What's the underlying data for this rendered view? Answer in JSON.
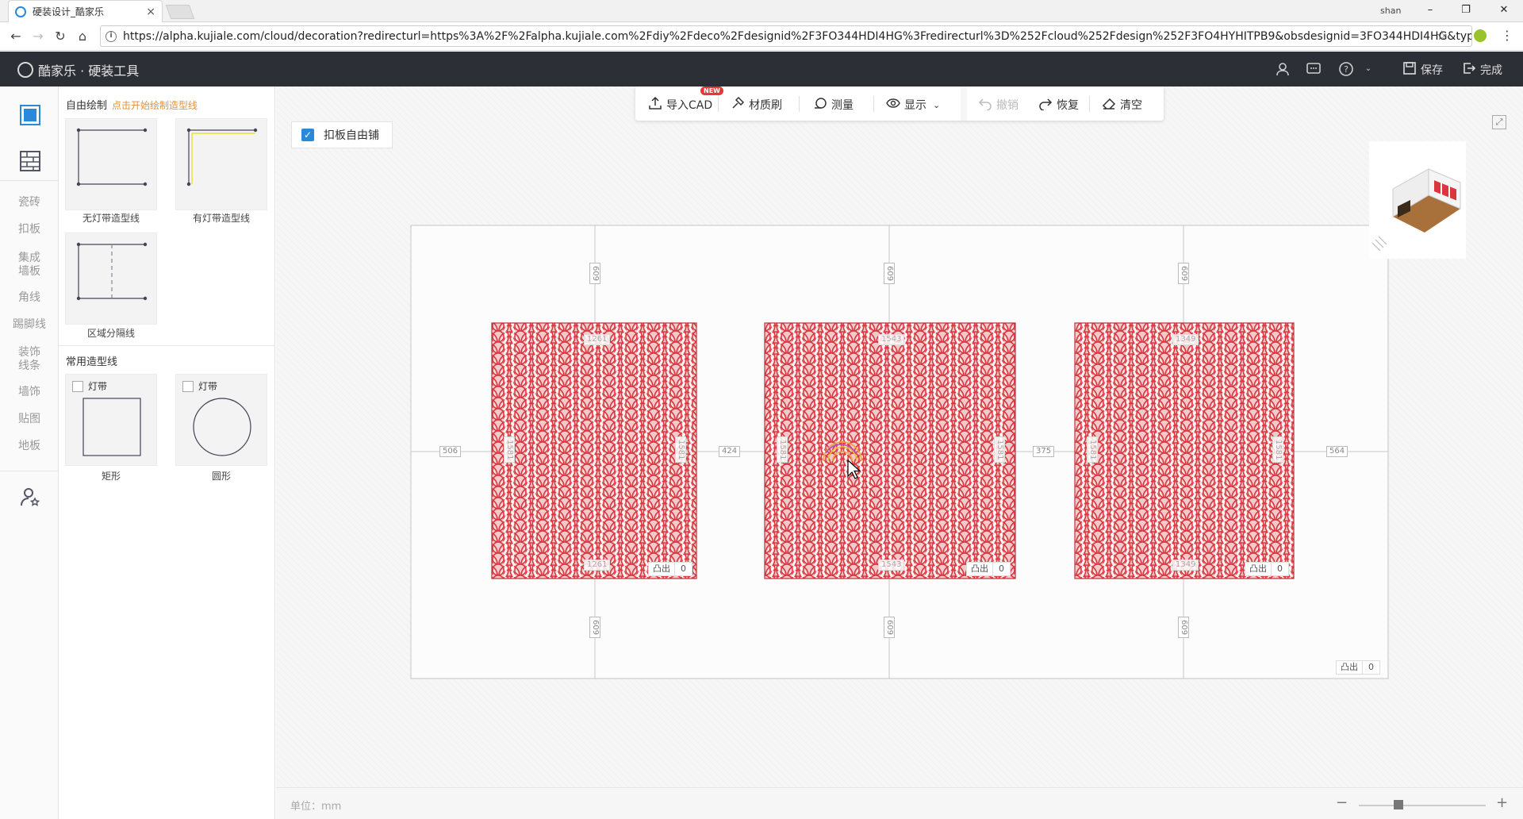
{
  "browser": {
    "tab_title": "硬装设计_酷家乐",
    "tab_close": "×",
    "user_label": "shan",
    "url": "https://alpha.kujiale.com/cloud/decoration?redirecturl=https%3A%2F%2Falpha.kujiale.com%2Fdiy%2Fdeco%2Fdesignid%2F3FO344HDI4HG%3Fredirecturl%3D%252Fcloud%252Fdesign%252F3FO4HYHITPB9&obsdesignid=3FO344HDI4HG&type=..."
  },
  "header": {
    "logo_text": "酷家乐 · 硬装工具",
    "save_label": "保存",
    "finish_label": "完成"
  },
  "rail": {
    "items": [
      "瓷砖",
      "扣板",
      "集成\n墙板",
      "角线",
      "踢脚线",
      "装饰\n线条",
      "墙饰",
      "贴图",
      "地板"
    ]
  },
  "panel": {
    "free_draw_title": "自由绘制",
    "free_draw_hint": "点击开始绘制造型线",
    "shapes": [
      {
        "label": "无灯带造型线"
      },
      {
        "label": "有灯带造型线"
      },
      {
        "label": "区域分隔线"
      }
    ],
    "common_title": "常用造型线",
    "common": [
      {
        "label": "矩形",
        "checkbox_label": "灯带"
      },
      {
        "label": "圆形",
        "checkbox_label": "灯带"
      }
    ]
  },
  "toolbar": {
    "import_cad": "导入CAD",
    "new_badge": "NEW",
    "material_brush": "材质刷",
    "measure": "测量",
    "display": "显示",
    "undo": "撤销",
    "redo": "恢复",
    "clear": "清空"
  },
  "canvas": {
    "free_tile_label": "扣板自由铺",
    "gaps": {
      "left": "506",
      "mid1": "424",
      "mid2": "375",
      "right": "564"
    },
    "panels": [
      {
        "top_dim": "609",
        "bottom_dim": "609",
        "width_dim": "1261",
        "height_dim": "1581",
        "protrude_label": "凸出",
        "protrude_value": "0"
      },
      {
        "top_dim": "609",
        "bottom_dim": "609",
        "width_dim": "1543",
        "height_dim": "1581",
        "protrude_label": "凸出",
        "protrude_value": "0"
      },
      {
        "top_dim": "609",
        "bottom_dim": "609",
        "width_dim": "1349",
        "height_dim": "1581",
        "protrude_label": "凸出",
        "protrude_value": "0"
      }
    ],
    "wall_protrude_label": "凸出",
    "wall_protrude_value": "0",
    "unit_label": "单位：mm"
  },
  "colors": {
    "header_bg": "#2c2f36",
    "accent": "#2a89d8",
    "hint": "#e3923d",
    "pattern_red": "#d9363e"
  }
}
